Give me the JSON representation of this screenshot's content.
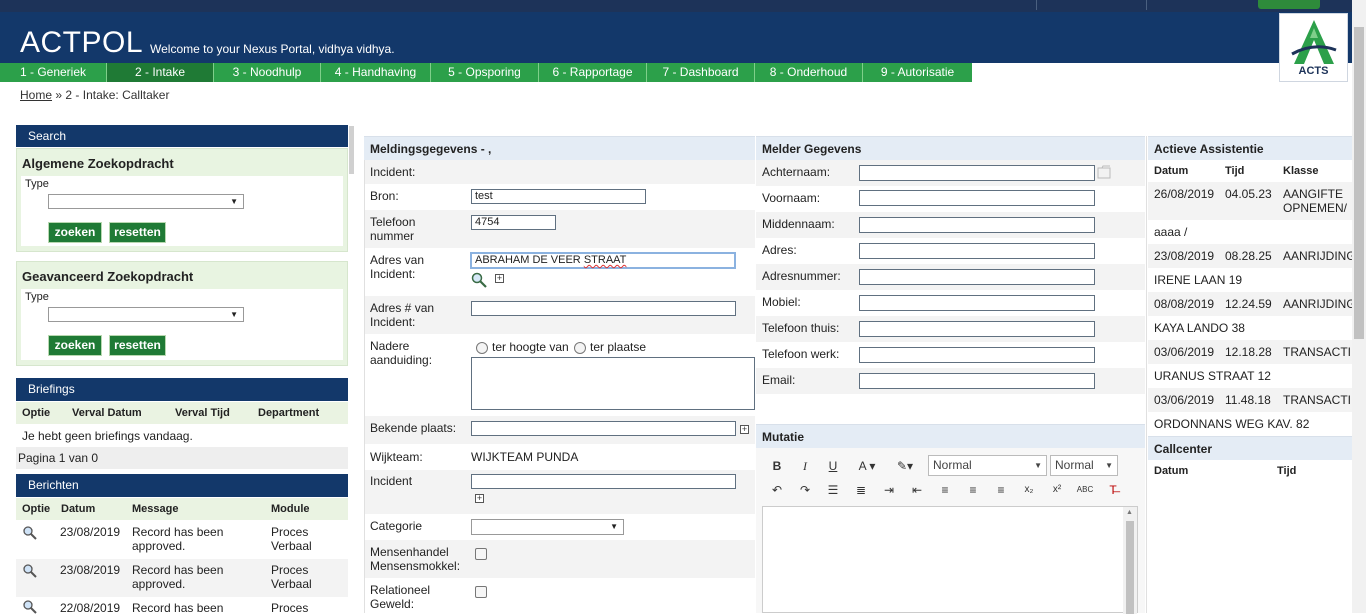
{
  "header": {
    "app_title": "ACTPOL",
    "welcome": "Welcome to your Nexus Portal, vidhya vidhya.",
    "logo_text": "ACTS"
  },
  "tabs": [
    {
      "label": "1 - Generiek"
    },
    {
      "label": "2 - Intake"
    },
    {
      "label": "3 - Noodhulp"
    },
    {
      "label": "4 - Handhaving"
    },
    {
      "label": "5 - Opsporing"
    },
    {
      "label": "6 - Rapportage"
    },
    {
      "label": "7 - Dashboard"
    },
    {
      "label": "8 - Onderhoud"
    },
    {
      "label": "9 - Autorisatie"
    }
  ],
  "breadcrumb": {
    "home": "Home",
    "sep": "»",
    "current": "2 - Intake: Calltaker"
  },
  "search": {
    "title": "Search",
    "general": {
      "title": "Algemene Zoekopdracht",
      "type_label": "Type",
      "search_btn": "zoeken",
      "reset_btn": "resetten"
    },
    "advanced": {
      "title": "Geavanceerd Zoekopdracht",
      "type_label": "Type",
      "search_btn": "zoeken",
      "reset_btn": "resetten"
    }
  },
  "briefings": {
    "title": "Briefings",
    "columns": [
      "Optie",
      "Verval Datum",
      "Verval Tijd",
      "Department"
    ],
    "empty": "Je hebt geen briefings vandaag.",
    "pagination": "Pagina 1 van 0"
  },
  "berichten": {
    "title": "Berichten",
    "columns": [
      "Optie",
      "Datum",
      "Message",
      "Module"
    ],
    "rows": [
      {
        "date": "23/08/2019",
        "message": "Record has been approved.",
        "module": "Proces Verbaal"
      },
      {
        "date": "23/08/2019",
        "message": "Record has been approved.",
        "module": "Proces Verbaal"
      },
      {
        "date": "22/08/2019",
        "message": "Record has been",
        "module": "Proces"
      }
    ]
  },
  "melding": {
    "title": "Meldingsgegevens - ,",
    "incident_label": "Incident:",
    "bron_label": "Bron:",
    "bron_value": "test",
    "telefoon_label": "Telefoon nummer",
    "telefoon_value": "4754",
    "adres_label": "Adres van Incident:",
    "adres_value_a": "ABRAHAM DE VEER ",
    "adres_value_b": "STRAAT",
    "adresnr_label": "Adres # van Incident:",
    "nadere_label": "Nadere aanduiding:",
    "radio1": "ter hoogte van",
    "radio2": "ter plaatse",
    "bekende_label": "Bekende plaats:",
    "wijkteam_label": "Wijkteam:",
    "wijkteam_value": "WIJKTEAM PUNDA",
    "incident2_label": "Incident",
    "categorie_label": "Categorie",
    "mensenhandel_label": "Mensenhandel Mensensmokkel:",
    "relationeel_label": "Relationeel Geweld:"
  },
  "melder": {
    "title": "Melder Gegevens",
    "fields": [
      "Achternaam:",
      "Voornaam:",
      "Middennaam:",
      "Adres:",
      "Adresnummer:",
      "Mobiel:",
      "Telefoon thuis:",
      "Telefoon werk:",
      "Email:"
    ]
  },
  "mutatie": {
    "title": "Mutatie",
    "format_select": "Normal",
    "size_select": "Normal"
  },
  "assistentie": {
    "title": "Actieve Assistentie",
    "columns": [
      "Datum",
      "Tijd",
      "Klasse"
    ],
    "rows": [
      {
        "date": "26/08/2019",
        "time": "04.05.23",
        "klasse": "AANGIFTE OPNEMEN/",
        "address": "aaaa  /"
      },
      {
        "date": "23/08/2019",
        "time": "08.28.25",
        "klasse": "AANRIJDING",
        "address": "IRENE LAAN  19"
      },
      {
        "date": "08/08/2019",
        "time": "12.24.59",
        "klasse": "AANRIJDING",
        "address": "KAYA LANDO  38"
      },
      {
        "date": "03/06/2019",
        "time": "12.18.28",
        "klasse": "TRANSACTI",
        "address": "URANUS STRAAT  12"
      },
      {
        "date": "03/06/2019",
        "time": "11.48.18",
        "klasse": "TRANSACTI",
        "address": "ORDONNANS WEG  KAV. 82"
      }
    ]
  },
  "callcenter": {
    "title": "Callcenter",
    "columns": [
      "Datum",
      "Tijd"
    ]
  }
}
